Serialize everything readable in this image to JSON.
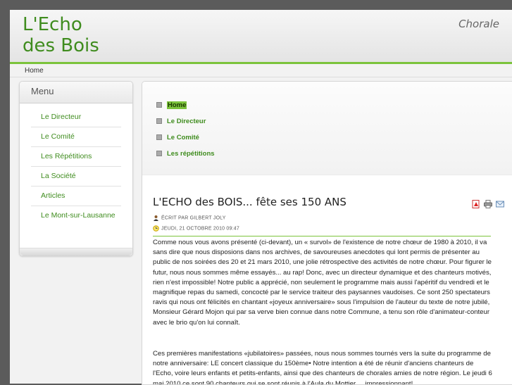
{
  "header": {
    "logo_line1": "L'Echo",
    "logo_line2": "des Bois",
    "tagline": "Chorale"
  },
  "breadcrumb": "Home",
  "sidebar": {
    "title": "Menu",
    "items": [
      {
        "label": "Le Directeur"
      },
      {
        "label": "Le Comité"
      },
      {
        "label": "Les Répétitions"
      },
      {
        "label": "La Société"
      },
      {
        "label": "Articles"
      },
      {
        "label": "Le Mont-sur-Lausanne"
      }
    ]
  },
  "topnav": {
    "items": [
      {
        "label": "Home",
        "active": true
      },
      {
        "label": "Le Directeur"
      },
      {
        "label": "Le Comité"
      },
      {
        "label": "Les répétitions"
      }
    ]
  },
  "article": {
    "title": "L'ECHO des BOIS... fête ses 150 ANS",
    "icons": [
      "pdf-icon",
      "print-icon",
      "email-icon"
    ],
    "author": "ÉCRIT PAR GILBERT JOLY",
    "date": "JEUDI, 21 OCTOBRE 2010 09:47",
    "paragraph1": "Comme nous vous avons présenté (ci-devant), un « survol» de l'existence de notre chœur de 1980 à 2010, il va sans dire que nous disposions dans nos archives, de savoureuses anecdotes qui lont permis de présenter au public de nos soirées des 20 et 21 mars 2010, une jolie rétrospective des activités de notre chœur. Pour figurer le futur, nous nous sommes même essayés... au rap! Donc, avec un directeur dynamique et des chanteurs motivés, rien n'est impossible! Notre public a apprécié, non seulement le programme mais aussi l'apéritif du vendredi et le magnifique repas du samedi, concocté par le service traiteur des paysannes vaudoises. Ce sont 250 spectateurs ravis qui nous ont félicités en chantant «joyeux anniversaire» sous l'impulsion de l'auteur du texte de notre jubilé, Monsieur Gérard Mojon qui par sa verve bien connue dans notre Commune, a tenu son rôle d'animateur-conteur avec le brio qu'on lui connaît.",
    "paragraph2": "Ces premières manifestations «jubilatoires» passées, nous nous sommes tournés vers la suite du programme de notre anniversaire: LE concert classique du 150ème• Notre intention a été de réunir d'anciens chanteurs de l'Echo, voire leurs enfants et petits-enfants, ainsi que des chanteurs de chorales amies de notre région. Le jeudi 6 mai 2010 ce sont 90 chanteurs qui se sont réunis à l'Aula du Mottier ... impressionnant!"
  },
  "colors": {
    "accent": "#7cc33b",
    "link": "#3f8c1e",
    "frame": "#5b5b5b"
  }
}
